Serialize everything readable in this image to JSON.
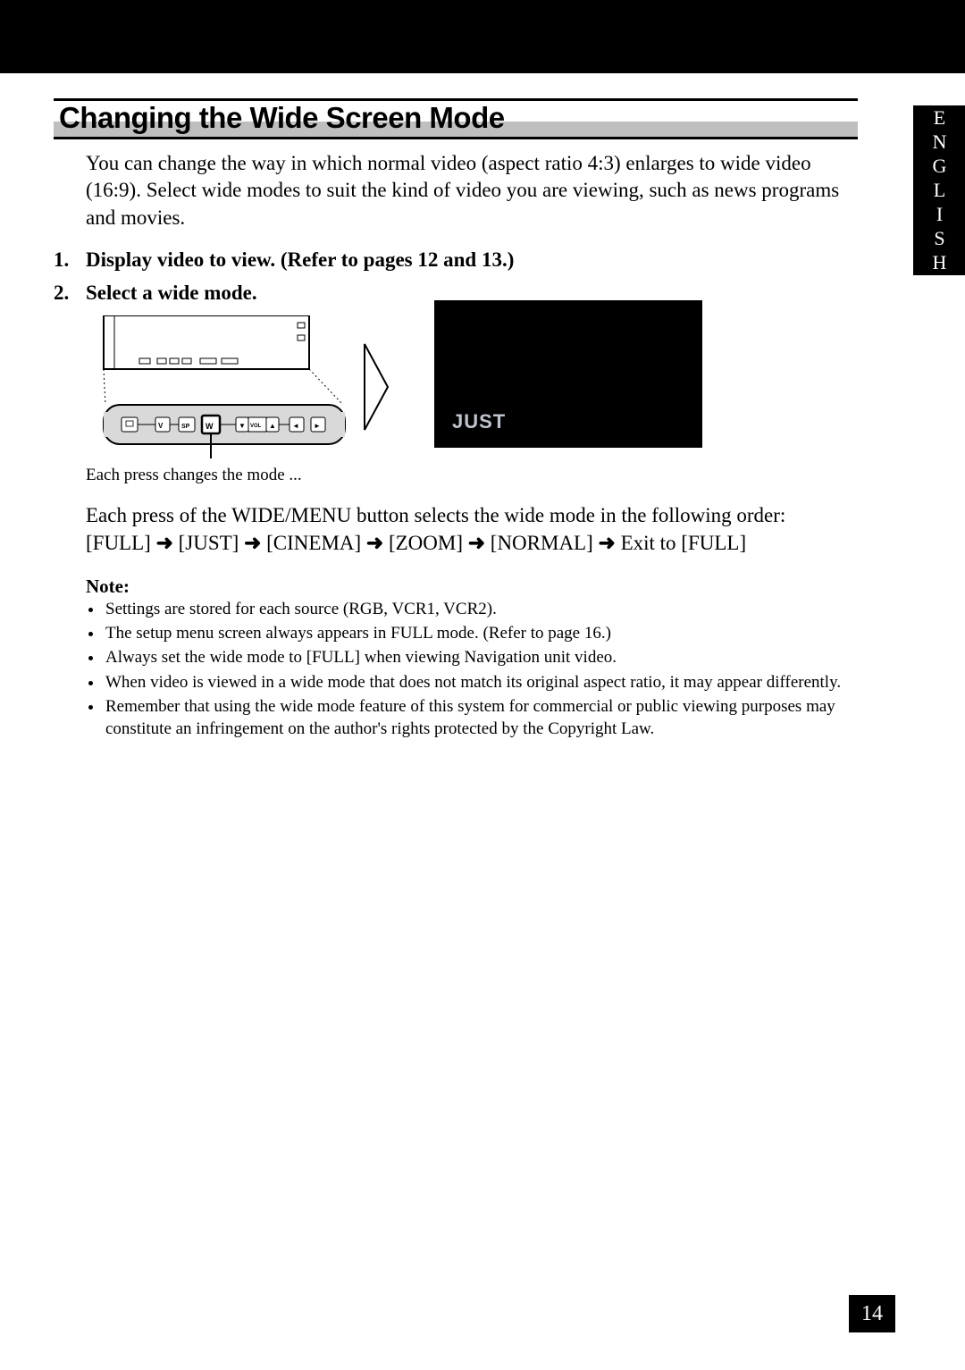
{
  "lang_tab": "ENGLISH",
  "title": "Changing the Wide Screen Mode",
  "intro": "You can change the way in which normal video (aspect ratio 4:3) enlarges to wide video (16:9). Select wide modes to suit the kind of video you are viewing, such as news programs and movies.",
  "steps": {
    "s1_num": "1.",
    "s1_text": "Display video to view. (Refer to pages 12 and 13.)",
    "s2_num": "2.",
    "s2_text": "Select a wide mode."
  },
  "figure": {
    "screen_label": "JUST",
    "caption": "Each press changes the mode ..."
  },
  "device_buttons": {
    "b1": "V",
    "b2": "SP",
    "b3": "W",
    "b4": "▼",
    "b5": "VOL",
    "b6": "▲",
    "b7": "◄",
    "b8": "►"
  },
  "explain": {
    "line1": "Each press of the WIDE/MENU button selects the wide mode in the following order:",
    "seq_full": "[FULL]",
    "seq_just": "[JUST]",
    "seq_cinema": "[CINEMA]",
    "seq_zoom": "[ZOOM]",
    "seq_normal": "[NORMAL]",
    "seq_exit": "Exit to [FULL]",
    "arrow": "➜"
  },
  "note_heading": "Note:",
  "notes": {
    "n0": "Settings are stored for each source (RGB, VCR1, VCR2).",
    "n1": "The setup menu screen always appears in FULL mode. (Refer to page 16.)",
    "n2": "Always set the wide mode to [FULL] when viewing Navigation unit video.",
    "n3": "When video is viewed in a wide mode that does not match its original aspect ratio, it may appear differently.",
    "n4": "Remember that using the wide mode feature of this system for commercial or public viewing purposes may constitute an infringement on the author's rights protected by the Copyright Law."
  },
  "page_number": "14"
}
